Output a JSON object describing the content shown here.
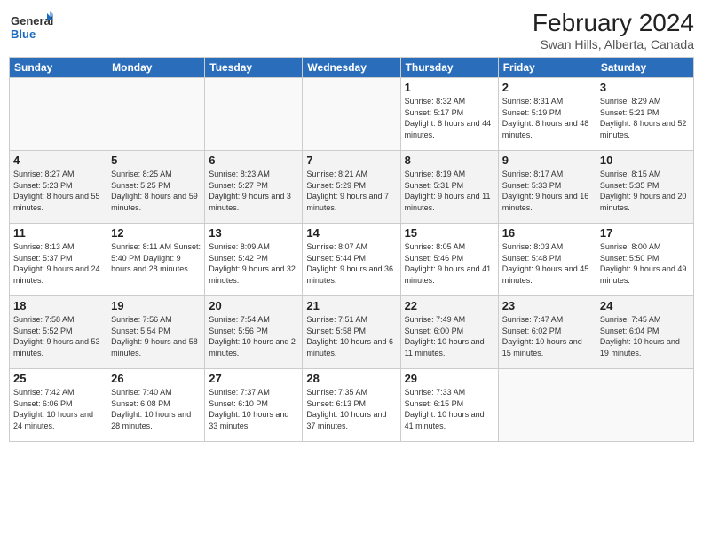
{
  "header": {
    "logo_general": "General",
    "logo_blue": "Blue",
    "title": "February 2024",
    "subtitle": "Swan Hills, Alberta, Canada"
  },
  "days_of_week": [
    "Sunday",
    "Monday",
    "Tuesday",
    "Wednesday",
    "Thursday",
    "Friday",
    "Saturday"
  ],
  "weeks": [
    [
      {
        "num": "",
        "info": ""
      },
      {
        "num": "",
        "info": ""
      },
      {
        "num": "",
        "info": ""
      },
      {
        "num": "",
        "info": ""
      },
      {
        "num": "1",
        "info": "Sunrise: 8:32 AM\nSunset: 5:17 PM\nDaylight: 8 hours\nand 44 minutes."
      },
      {
        "num": "2",
        "info": "Sunrise: 8:31 AM\nSunset: 5:19 PM\nDaylight: 8 hours\nand 48 minutes."
      },
      {
        "num": "3",
        "info": "Sunrise: 8:29 AM\nSunset: 5:21 PM\nDaylight: 8 hours\nand 52 minutes."
      }
    ],
    [
      {
        "num": "4",
        "info": "Sunrise: 8:27 AM\nSunset: 5:23 PM\nDaylight: 8 hours\nand 55 minutes."
      },
      {
        "num": "5",
        "info": "Sunrise: 8:25 AM\nSunset: 5:25 PM\nDaylight: 8 hours\nand 59 minutes."
      },
      {
        "num": "6",
        "info": "Sunrise: 8:23 AM\nSunset: 5:27 PM\nDaylight: 9 hours\nand 3 minutes."
      },
      {
        "num": "7",
        "info": "Sunrise: 8:21 AM\nSunset: 5:29 PM\nDaylight: 9 hours\nand 7 minutes."
      },
      {
        "num": "8",
        "info": "Sunrise: 8:19 AM\nSunset: 5:31 PM\nDaylight: 9 hours\nand 11 minutes."
      },
      {
        "num": "9",
        "info": "Sunrise: 8:17 AM\nSunset: 5:33 PM\nDaylight: 9 hours\nand 16 minutes."
      },
      {
        "num": "10",
        "info": "Sunrise: 8:15 AM\nSunset: 5:35 PM\nDaylight: 9 hours\nand 20 minutes."
      }
    ],
    [
      {
        "num": "11",
        "info": "Sunrise: 8:13 AM\nSunset: 5:37 PM\nDaylight: 9 hours\nand 24 minutes."
      },
      {
        "num": "12",
        "info": "Sunrise: 8:11 AM\nSunset: 5:40 PM\nDaylight: 9 hours\nand 28 minutes."
      },
      {
        "num": "13",
        "info": "Sunrise: 8:09 AM\nSunset: 5:42 PM\nDaylight: 9 hours\nand 32 minutes."
      },
      {
        "num": "14",
        "info": "Sunrise: 8:07 AM\nSunset: 5:44 PM\nDaylight: 9 hours\nand 36 minutes."
      },
      {
        "num": "15",
        "info": "Sunrise: 8:05 AM\nSunset: 5:46 PM\nDaylight: 9 hours\nand 41 minutes."
      },
      {
        "num": "16",
        "info": "Sunrise: 8:03 AM\nSunset: 5:48 PM\nDaylight: 9 hours\nand 45 minutes."
      },
      {
        "num": "17",
        "info": "Sunrise: 8:00 AM\nSunset: 5:50 PM\nDaylight: 9 hours\nand 49 minutes."
      }
    ],
    [
      {
        "num": "18",
        "info": "Sunrise: 7:58 AM\nSunset: 5:52 PM\nDaylight: 9 hours\nand 53 minutes."
      },
      {
        "num": "19",
        "info": "Sunrise: 7:56 AM\nSunset: 5:54 PM\nDaylight: 9 hours\nand 58 minutes."
      },
      {
        "num": "20",
        "info": "Sunrise: 7:54 AM\nSunset: 5:56 PM\nDaylight: 10 hours\nand 2 minutes."
      },
      {
        "num": "21",
        "info": "Sunrise: 7:51 AM\nSunset: 5:58 PM\nDaylight: 10 hours\nand 6 minutes."
      },
      {
        "num": "22",
        "info": "Sunrise: 7:49 AM\nSunset: 6:00 PM\nDaylight: 10 hours\nand 11 minutes."
      },
      {
        "num": "23",
        "info": "Sunrise: 7:47 AM\nSunset: 6:02 PM\nDaylight: 10 hours\nand 15 minutes."
      },
      {
        "num": "24",
        "info": "Sunrise: 7:45 AM\nSunset: 6:04 PM\nDaylight: 10 hours\nand 19 minutes."
      }
    ],
    [
      {
        "num": "25",
        "info": "Sunrise: 7:42 AM\nSunset: 6:06 PM\nDaylight: 10 hours\nand 24 minutes."
      },
      {
        "num": "26",
        "info": "Sunrise: 7:40 AM\nSunset: 6:08 PM\nDaylight: 10 hours\nand 28 minutes."
      },
      {
        "num": "27",
        "info": "Sunrise: 7:37 AM\nSunset: 6:10 PM\nDaylight: 10 hours\nand 33 minutes."
      },
      {
        "num": "28",
        "info": "Sunrise: 7:35 AM\nSunset: 6:13 PM\nDaylight: 10 hours\nand 37 minutes."
      },
      {
        "num": "29",
        "info": "Sunrise: 7:33 AM\nSunset: 6:15 PM\nDaylight: 10 hours\nand 41 minutes."
      },
      {
        "num": "",
        "info": ""
      },
      {
        "num": "",
        "info": ""
      }
    ]
  ]
}
